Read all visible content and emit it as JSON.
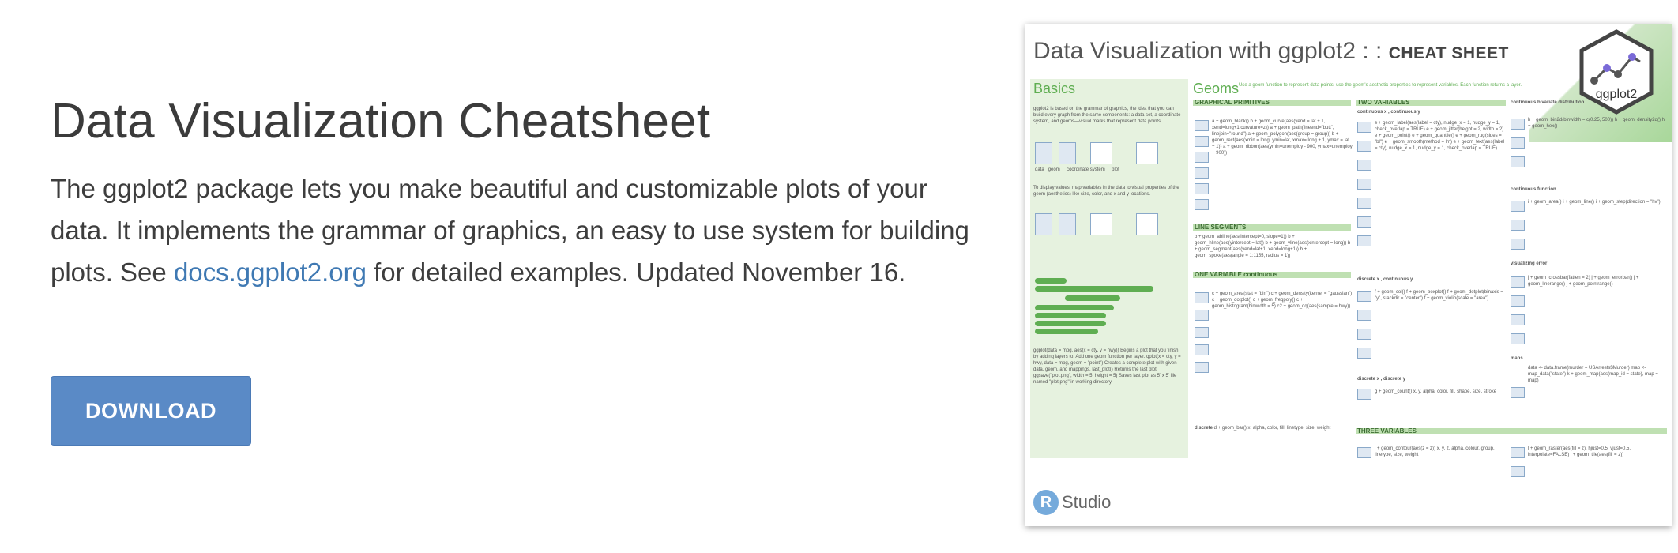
{
  "hero": {
    "title": "Data Visualization Cheatsheet",
    "desc_before": "The ggplot2 package lets you make beautiful and customizable plots of your data. It implements the grammar of graphics, an easy to use system for building plots. See ",
    "desc_link": "docs.ggplot2.org",
    "desc_after": " for detailed examples. Updated November 16.",
    "download_label": "DOWNLOAD"
  },
  "thumbnail": {
    "title_main": "Data Visualization with ggplot2 : : ",
    "title_bold": "CHEAT SHEET",
    "hex_label": "ggplot2",
    "basics_heading": "Basics",
    "geoms_heading": "Geoms",
    "geoms_subtitle": "Use a geom function to represent data points, use the geom's aesthetic properties to represent variables. Each function returns a layer.",
    "panels": {
      "graphical_primitives": "GRAPHICAL PRIMITIVES",
      "two_variables": "TWO VARIABLES",
      "continuous_xy": "continuous x , continuous y",
      "continuous_bivariate": "continuous bivariate distribution",
      "line_segments": "LINE SEGMENTS",
      "one_variable": "ONE VARIABLE  continuous",
      "discrete_continuous": "discrete x , continuous y",
      "continuous_function": "continuous function",
      "visualizing_error": "visualizing error",
      "maps": "maps",
      "discrete_discrete": "discrete x , discrete y",
      "three_variables": "THREE VARIABLES",
      "discrete": "discrete"
    },
    "basics_labels": {
      "data": "data",
      "geom": "geom",
      "coord": "coordinate system",
      "plot": "plot"
    },
    "rstudio_label": "Studio",
    "rstudio_letter": "R"
  },
  "colors": {
    "download_bg": "#5a8ac6",
    "link": "#3f79b3",
    "ggplot_green": "#5fae52"
  }
}
